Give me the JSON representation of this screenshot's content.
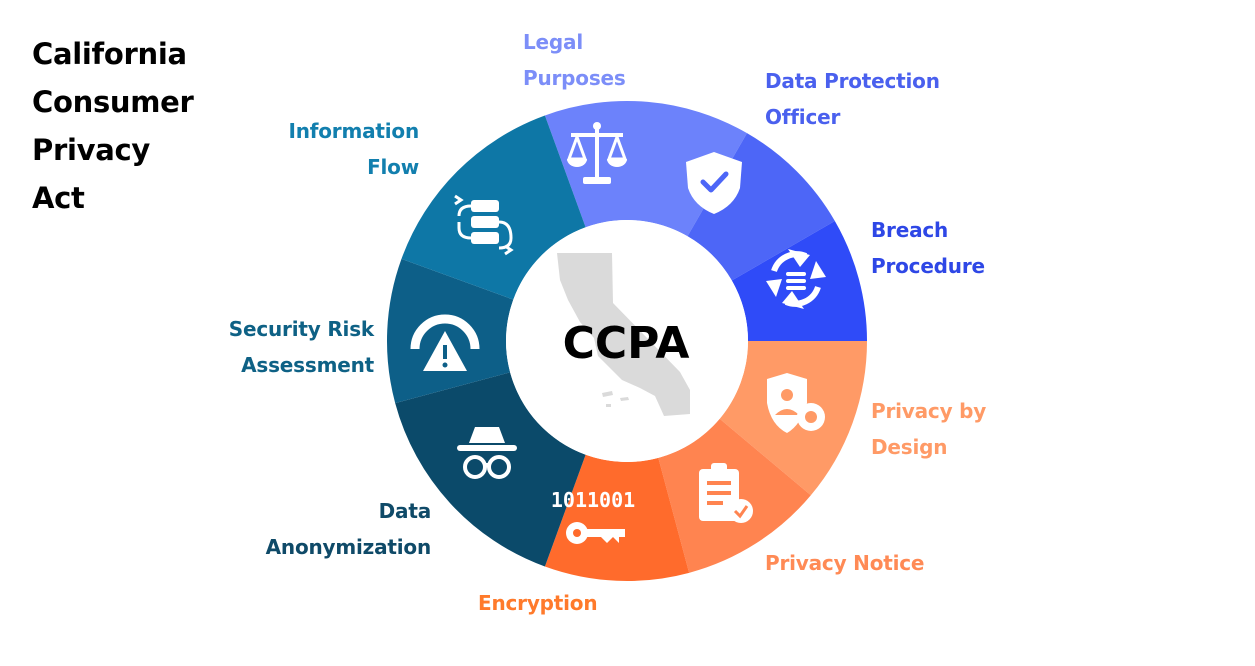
{
  "title": {
    "line1": "California",
    "line2": "Consumer",
    "line3": "Privacy",
    "line4": "Act"
  },
  "center": {
    "label": "CCPA"
  },
  "segments": [
    {
      "line1": "Legal",
      "line2": "Purposes",
      "icon": "scales-icon",
      "color": "#6C82FB",
      "label_color": "#7C8EF8"
    },
    {
      "line1": "Data Protection",
      "line2": "Officer",
      "icon": "shield-check-icon",
      "color": "#4D66F7",
      "label_color": "#4A60EE"
    },
    {
      "line1": "Breach",
      "line2": "Procedure",
      "icon": "refresh-cycle-icon",
      "color": "#2F4BF8",
      "label_color": "#2E47E6"
    },
    {
      "line1": "Privacy by",
      "line2": "Design",
      "icon": "user-gear-shield-icon",
      "color": "#FF9A66",
      "label_color": "#FF9A66"
    },
    {
      "line1": "Privacy Notice",
      "line2": "",
      "icon": "clipboard-check-icon",
      "color": "#FF8450",
      "label_color": "#FF8A55"
    },
    {
      "line1": "Encryption",
      "line2": "",
      "icon": "binary-key-icon",
      "color": "#FF6B2C",
      "label_color": "#FF7A2B"
    },
    {
      "line1": "Data",
      "line2": "Anonymization",
      "icon": "incognito-icon",
      "color": "#0B4A6A",
      "label_color": "#0F4A68"
    },
    {
      "line1": "Security Risk",
      "line2": "Assessment",
      "icon": "risk-gauge-icon",
      "color": "#0D5F88",
      "label_color": "#0E6185"
    },
    {
      "line1": "Information",
      "line2": "Flow",
      "icon": "data-flow-icon",
      "color": "#0E77A6",
      "label_color": "#127FAE"
    }
  ]
}
